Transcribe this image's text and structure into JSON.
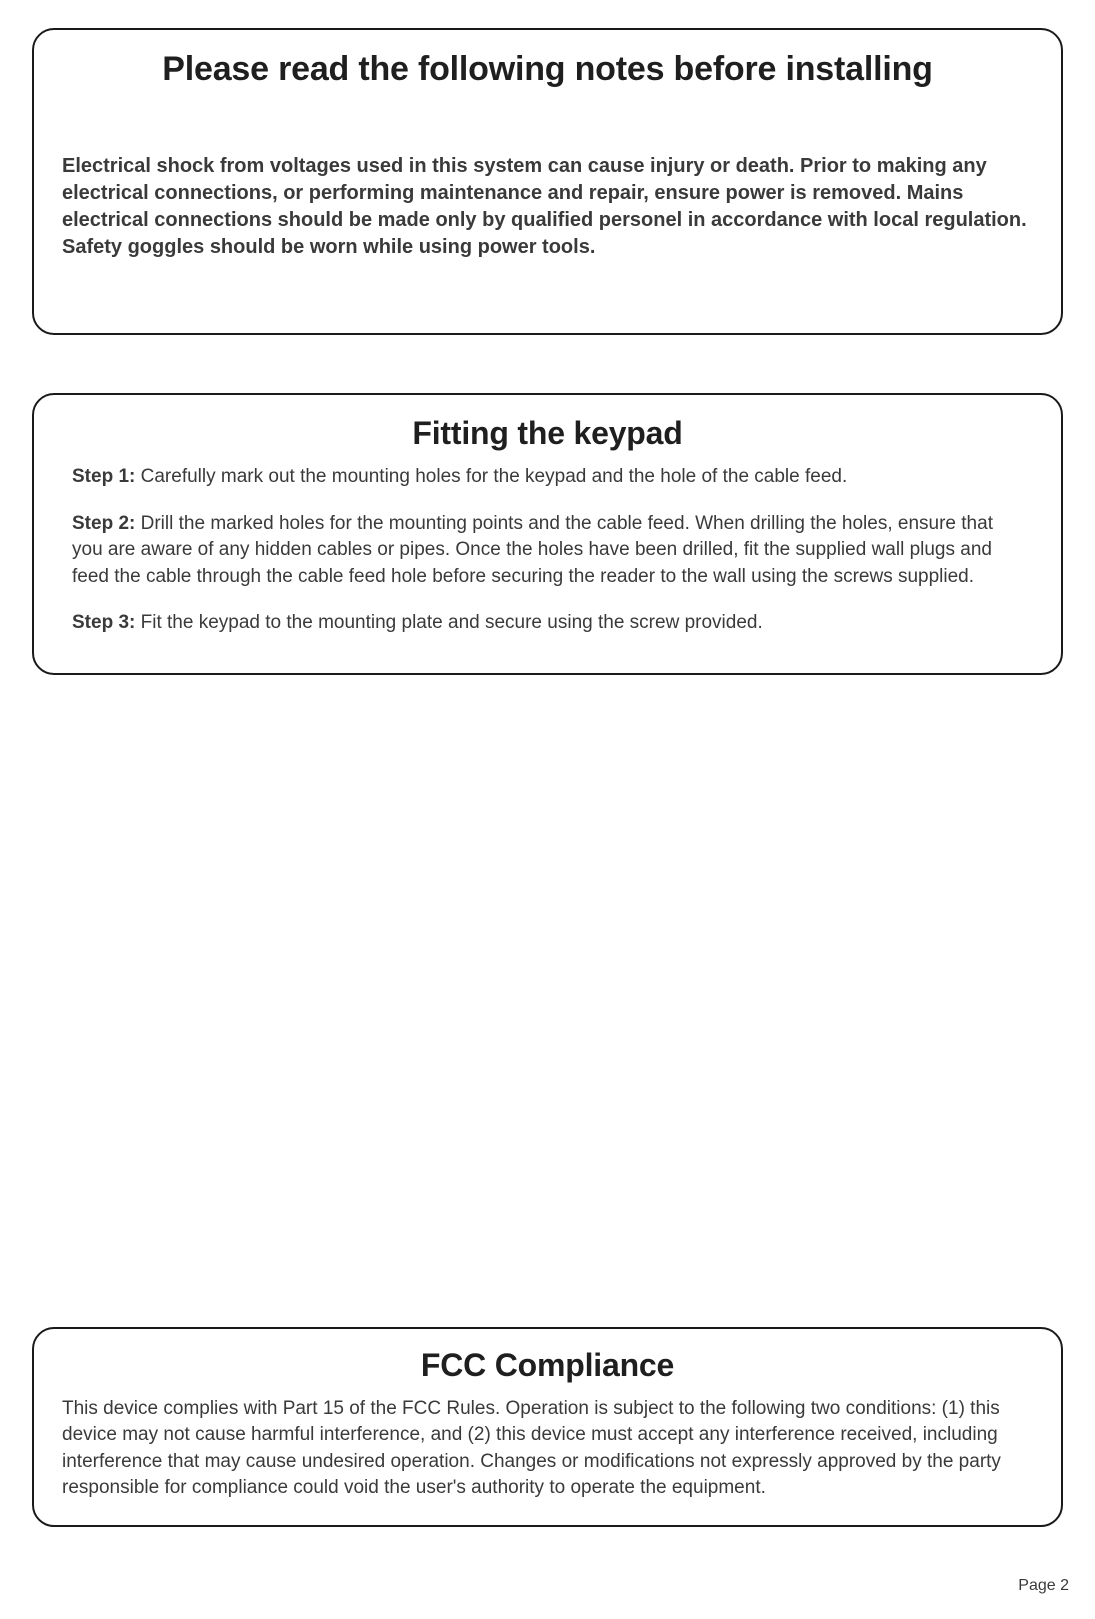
{
  "warning": {
    "title": "Please read the following notes before installing",
    "body": "Electrical shock from voltages used in this system can cause injury or death. Prior to making any electrical connections, or performing maintenance and repair, ensure power is removed. Mains electrical connections should be made only by qualified personel in accordance with local regulation. Safety goggles should be worn while using power tools."
  },
  "fitting": {
    "title": "Fitting the keypad",
    "steps": [
      {
        "label": "Step 1:",
        "text": " Carefully mark out the mounting holes for the keypad and the hole of the cable feed."
      },
      {
        "label": "Step 2:",
        "text": " Drill the marked holes for the mounting points and the cable feed. When drilling the holes, ensure that you are aware of any hidden cables or pipes.  Once the holes have been drilled, fit the supplied wall plugs and feed the cable through the cable feed hole before securing the reader to the wall using the screws supplied."
      },
      {
        "label": "Step 3:",
        "text": " Fit the keypad to the mounting plate and secure using the screw provided."
      }
    ]
  },
  "fcc": {
    "title": "FCC Compliance",
    "body": "This device complies with Part 15 of the FCC Rules. Operation is subject to the following two conditions: (1) this device may not cause harmful interference, and (2) this device must accept any interference received, including interference that may cause undesired operation.  Changes or modifications not expressly approved by the party responsible for compliance could void the user's authority to operate the equipment."
  },
  "page_label": "Page 2"
}
